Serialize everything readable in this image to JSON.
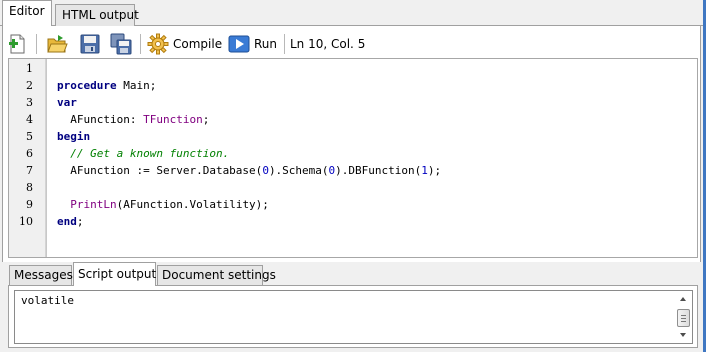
{
  "tabs": {
    "editor": "Editor",
    "html_output": "HTML output"
  },
  "toolbar": {
    "compile_label": "Compile",
    "run_label": "Run",
    "cursor_position": "Ln 10, Col. 5"
  },
  "editor": {
    "line_numbers": [
      "1",
      "2",
      "3",
      "4",
      "5",
      "6",
      "7",
      "8",
      "9",
      "10"
    ],
    "code": {
      "l2_kw": "procedure",
      "l2_rest": " Main;",
      "l3_kw": "var",
      "l4_a": "  AFunction: ",
      "l4_type": "TFunction",
      "l4_end": ";",
      "l5_kw": "begin",
      "l6_comment": "  // Get a known function.",
      "l7_a": "  AFunction := Server.Database(",
      "l7_n1": "0",
      "l7_b": ").Schema(",
      "l7_n2": "0",
      "l7_c": ").DBFunction(",
      "l7_n3": "1",
      "l7_d": ");",
      "l9_indent": "  ",
      "l9_fn": "PrintLn",
      "l9_rest": "(AFunction.Volatility);",
      "l10_kw": "end",
      "l10_rest": ";"
    }
  },
  "bottom_tabs": {
    "messages": "Messages",
    "script_output": "Script output",
    "document_settings": "Document settings"
  },
  "output": {
    "text": "volatile"
  },
  "icons": {
    "new": "new-document-icon",
    "open": "open-folder-icon",
    "save": "save-icon",
    "save_all": "save-all-icon",
    "compile": "gear-icon",
    "run": "play-icon"
  },
  "colors": {
    "keyword": "#000080",
    "type": "#800080",
    "comment": "#008000",
    "number": "#0000c0",
    "run_button": "#3a7bd5",
    "window_edge": "#3f77c2"
  }
}
